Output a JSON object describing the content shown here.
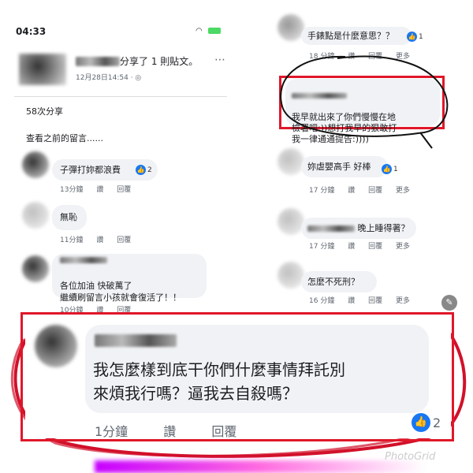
{
  "status_bar": {
    "time": "04:33",
    "icons": "◉ ▮"
  },
  "post_header": {
    "shared_text": "分享了 1 則貼文。",
    "date": "12月28日14:54 · ◎",
    "more": "⋯"
  },
  "shares_count": "58次分享",
  "view_previous": "查看之前的留言......",
  "left_comments": [
    {
      "text": "子彈打妳都浪費",
      "likes": "2",
      "time": "13分鐘",
      "like_label": "讚",
      "reply_label": "回覆"
    },
    {
      "text": "無恥",
      "time": "11分鐘",
      "like_label": "讚",
      "reply_label": "回覆"
    },
    {
      "text": "各位加油 快破萬了\n繼續刷留言小孩就會復活了！！",
      "time": "10分鐘",
      "like_label": "讚",
      "reply_label": "回覆"
    }
  ],
  "right_comments": [
    {
      "text": "手錶點是什麼意思？？",
      "likes": "1",
      "time": "18 分鐘",
      "like_label": "讚",
      "reply_label": "回覆",
      "more_label": "更多"
    },
    {
      "text": "我早就出來了你們慢慢在地\n檢署吧:))想打我早的狠敢打\n我一律通通提告:))))"
    },
    {
      "text": "妳虐嬰高手 好棒",
      "likes": "1",
      "time": "17 分鐘",
      "like_label": "讚",
      "reply_label": "回覆",
      "more_label": "更多"
    },
    {
      "text": "晚上睡得著？",
      "time": "17 分鐘",
      "like_label": "讚",
      "reply_label": "回覆",
      "more_label": "更多"
    },
    {
      "text": "怎麼不死刑？",
      "time": "16 分鐘",
      "like_label": "讚",
      "reply_label": "回覆",
      "more_label": "更多"
    }
  ],
  "highlight_comment": {
    "text": "我怎麼樣到底干你們什麼事情拜託別\n來煩我行嗎？逼我去自殺嗎？",
    "time": "1分鐘",
    "like_label": "讚",
    "reply_label": "回覆",
    "likes": "2"
  },
  "watermark": "PhotoGrid",
  "colors": {
    "highlight_red": "#e0172a",
    "fb_blue": "#1877f2",
    "bubble_gray": "#f0f2f5"
  },
  "icons": {
    "like": "thumbs-up-icon",
    "pencil": "pencil-icon"
  }
}
